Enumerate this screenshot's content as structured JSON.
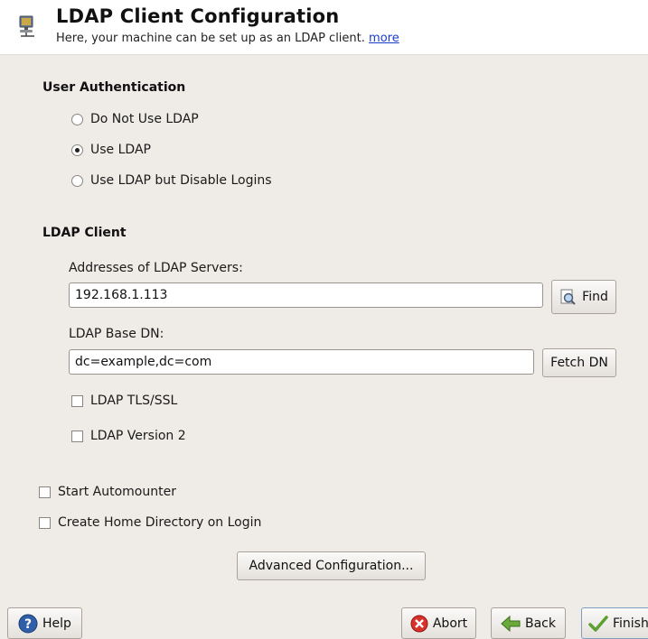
{
  "header": {
    "title": "LDAP Client Configuration",
    "subtitle": "Here, your machine can be set up as an LDAP client.",
    "more_link": "more",
    "icon": "computer-network-icon"
  },
  "user_auth": {
    "title": "User Authentication",
    "options": [
      {
        "label": "Do Not Use LDAP",
        "selected": false
      },
      {
        "label": "Use LDAP",
        "selected": true
      },
      {
        "label": "Use LDAP but Disable Logins",
        "selected": false
      }
    ]
  },
  "ldap_client": {
    "title": "LDAP Client",
    "servers_label": "Addresses of LDAP Servers:",
    "servers_value": "192.168.1.113",
    "find_button": "Find",
    "base_dn_label": "LDAP Base DN:",
    "base_dn_value": "dc=example,dc=com",
    "fetch_dn_button": "Fetch DN",
    "tls_ssl_label": "LDAP TLS/SSL",
    "tls_ssl_checked": false,
    "version2_label": "LDAP Version 2",
    "version2_checked": false
  },
  "automounter_label": "Start Automounter",
  "automounter_checked": false,
  "home_dir_label": "Create Home Directory on Login",
  "home_dir_checked": false,
  "advanced_button": "Advanced Configuration...",
  "footer": {
    "help": "Help",
    "abort": "Abort",
    "back": "Back",
    "finish": "Finish"
  }
}
